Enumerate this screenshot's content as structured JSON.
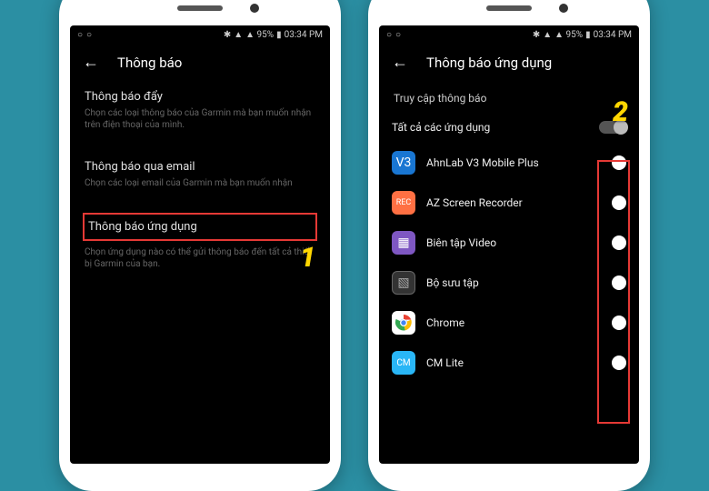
{
  "statusbar": {
    "signal": "▲ 95%",
    "time": "03:34 PM"
  },
  "phone1": {
    "title": "Thông báo",
    "sections": [
      {
        "title": "Thông báo đẩy",
        "desc": "Chọn các loại thông báo của Garmin mà bạn muốn nhận trên điện thoại của mình."
      },
      {
        "title": "Thông báo qua email",
        "desc": "Chọn các loại email của Garmin mà bạn muốn nhận"
      },
      {
        "title": "Thông báo ứng dụng",
        "desc": "Chọn ứng dụng nào có thể gửi thông báo đến tất cả thiết bị Garmin của bạn."
      }
    ],
    "step": "1"
  },
  "phone2": {
    "title": "Thông báo ứng dụng",
    "access_label": "Truy cập thông báo",
    "all_label": "Tất cả các ứng dụng",
    "apps": [
      {
        "name": "AhnLab V3 Mobile Plus",
        "icon": "ahnlab"
      },
      {
        "name": "AZ Screen Recorder",
        "icon": "az"
      },
      {
        "name": "Biên tập Video",
        "icon": "video"
      },
      {
        "name": "Bộ sưu tập",
        "icon": "gallery"
      },
      {
        "name": "Chrome",
        "icon": "chrome"
      },
      {
        "name": "CM Lite",
        "icon": "cm"
      }
    ],
    "step": "2"
  }
}
